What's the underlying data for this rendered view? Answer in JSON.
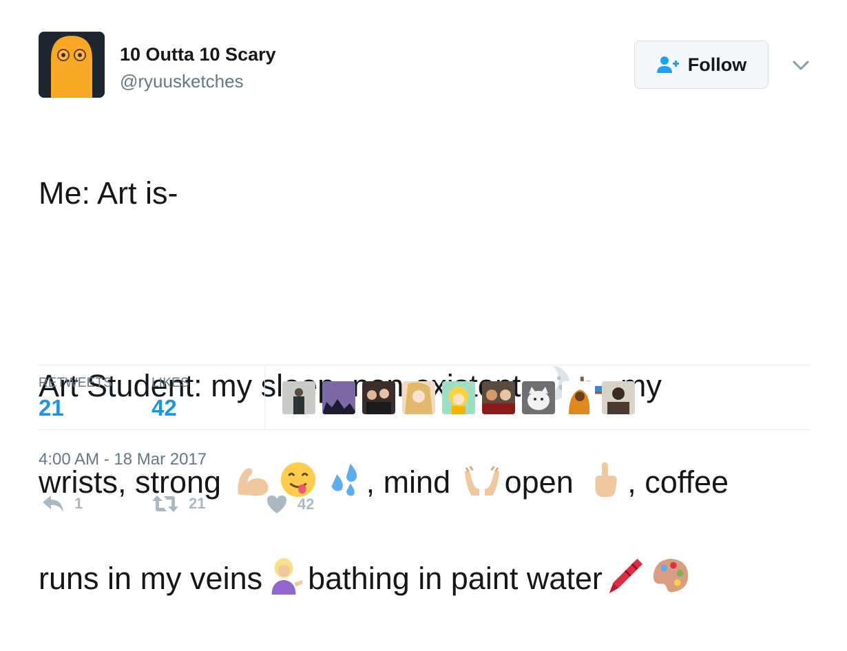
{
  "author": {
    "name": "10 Outta 10 Scary",
    "handle": "@ryuusketches"
  },
  "follow_button": {
    "label": "Follow",
    "icon": "add-user-icon"
  },
  "tweet": {
    "line1": "Me: Art is-",
    "line2a": "Art Student: my sleep, non-existent ",
    "line2b": "my",
    "line3a": "wrists, strong ",
    "line3b": ", mind ",
    "line3c": "open ",
    "line3d": ", coffee",
    "line4a": "runs in my veins",
    "line4b": "bathing in paint water"
  },
  "stats": {
    "retweets_label": "RETWEETS",
    "retweets_value": "21",
    "likes_label": "LIKES",
    "likes_value": "42"
  },
  "timestamp": "4:00 AM - 18 Mar 2017",
  "actions": {
    "reply_count": "1",
    "retweet_count": "21",
    "like_count": "42"
  },
  "colors": {
    "accent": "#1b95e0",
    "muted": "#657786",
    "action": "#aab8c2",
    "avatar_figure": "#f7a825"
  }
}
